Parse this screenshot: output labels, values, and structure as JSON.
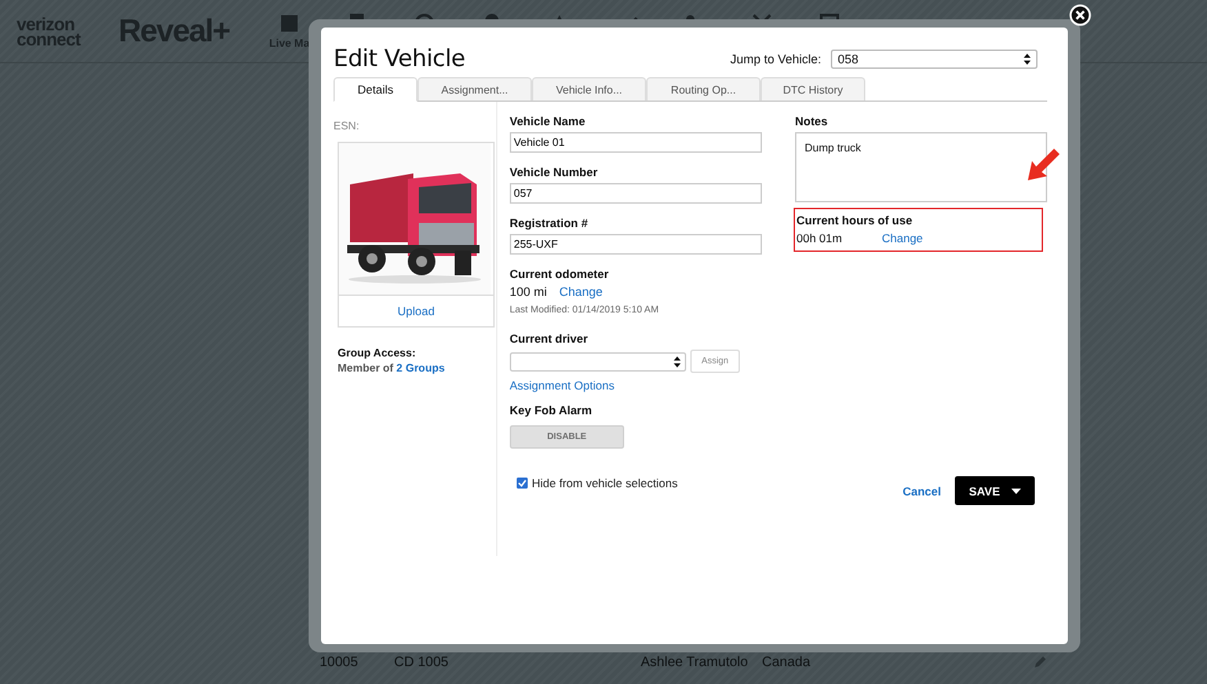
{
  "app_header": {
    "logo_top": "verizon",
    "logo_bottom": "connect",
    "product": "Reveal+",
    "nav_label": "Live Ma"
  },
  "background_row": {
    "cells": [
      "10005",
      "CD 1005",
      "Ashlee Tramutolo",
      "Canada"
    ]
  },
  "dialog": {
    "title": "Edit Vehicle",
    "jump_label": "Jump to Vehicle:",
    "jump_value": "058",
    "tabs": [
      {
        "label": "Details",
        "selected": true
      },
      {
        "label": "Assignment...",
        "selected": false
      },
      {
        "label": "Vehicle Info...",
        "selected": false
      },
      {
        "label": "Routing Op...",
        "selected": false
      },
      {
        "label": "DTC History",
        "selected": false
      }
    ],
    "esn_label": "ESN:",
    "upload": "Upload",
    "group_access_label": "Group Access:",
    "group_member_text": "Member of",
    "group_link": "2 Groups",
    "fields": [
      {
        "label": "Vehicle Name",
        "value": "Vehicle 01"
      },
      {
        "label": "Vehicle Number",
        "value": "057"
      },
      {
        "label": "Registration #",
        "value": "255-UXF"
      }
    ],
    "odometer": {
      "label": "Current odometer",
      "value": "100",
      "unit": "mi",
      "change": "Change",
      "modified": "Last Modified: 01/14/2019 5:10 AM"
    },
    "driver": {
      "label": "Current driver",
      "assign": "Assign",
      "options_link": "Assignment Options"
    },
    "key_fob": {
      "label": "Key Fob Alarm",
      "button": "DISABLE",
      "disabled": true
    },
    "notes": {
      "label": "Notes",
      "value": "Dump truck"
    },
    "hours": {
      "label": "Current hours of use",
      "value": "00h 01m",
      "change": "Change",
      "highlighted": true
    },
    "hide_checkbox": {
      "label": "Hide from vehicle selections",
      "checked": true
    },
    "cancel": "Cancel",
    "save": "SAVE"
  }
}
